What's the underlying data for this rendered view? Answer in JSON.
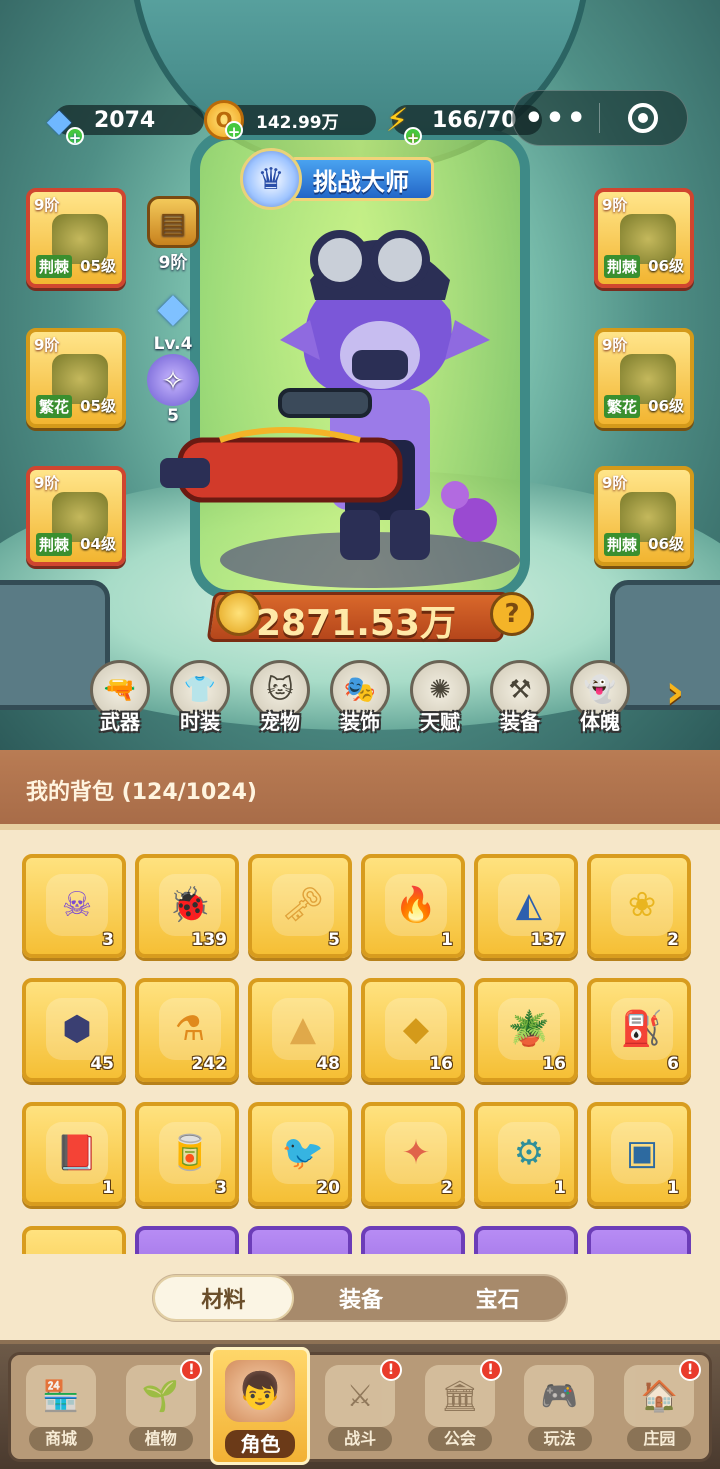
{
  "top_bar": {
    "gems": "2074",
    "coins": "142.99万",
    "energy": "166/70",
    "menu_dots": "•••"
  },
  "title_badge": "挑战大师",
  "equipment_left": [
    {
      "tier": "9阶",
      "tag": "荆棘",
      "level": "05级",
      "frame": "red"
    },
    {
      "tier": "9阶",
      "tag": "繁花",
      "level": "05级",
      "frame": "gold"
    },
    {
      "tier": "9阶",
      "tag": "荆棘",
      "level": "04级",
      "frame": "red"
    }
  ],
  "equipment_right": [
    {
      "tier": "9阶",
      "tag": "荆棘",
      "level": "06级",
      "frame": "red"
    },
    {
      "tier": "9阶",
      "tag": "繁花",
      "level": "06级",
      "frame": "gold"
    },
    {
      "tier": "9阶",
      "tag": "荆棘",
      "level": "06级",
      "frame": "gold"
    }
  ],
  "hero_stats": {
    "weapon_tier": "9阶",
    "level": "Lv.4",
    "star_count": "5"
  },
  "power": "2871.53万",
  "help_label": "?",
  "tabs": [
    "武器",
    "时装",
    "宠物",
    "装饰",
    "天赋",
    "装备",
    "体魄"
  ],
  "bag": {
    "title": "我的背包 (124/1024)",
    "items": [
      {
        "icon": "skull-scroll-icon",
        "glyph": "☠",
        "count": "3",
        "color": "#7c4bd1"
      },
      {
        "icon": "ladybug-icon",
        "glyph": "🐞",
        "count": "139",
        "color": "#d2402c"
      },
      {
        "icon": "key-icon",
        "glyph": "🗝",
        "count": "5",
        "color": "#e0a23a"
      },
      {
        "icon": "flame-gem-icon",
        "glyph": "🔥",
        "count": "1",
        "color": "#e04a1c"
      },
      {
        "icon": "prism-icon",
        "glyph": "◭",
        "count": "137",
        "color": "#2d5fae"
      },
      {
        "icon": "golden-bud-icon",
        "glyph": "❀",
        "count": "2",
        "color": "#e9b51f"
      },
      {
        "icon": "rune-stone-icon",
        "glyph": "⬢",
        "count": "45",
        "color": "#3a3f72"
      },
      {
        "icon": "potion-icon",
        "glyph": "⚗",
        "count": "242",
        "color": "#e08a1c"
      },
      {
        "icon": "sand-pile-icon",
        "glyph": "▲",
        "count": "48",
        "color": "#e0a94a"
      },
      {
        "icon": "gold-ore-icon",
        "glyph": "◆",
        "count": "16",
        "color": "#d49a1a"
      },
      {
        "icon": "flower-pot-icon",
        "glyph": "🪴",
        "count": "16",
        "color": "#b97a3a"
      },
      {
        "icon": "spray-tank-icon",
        "glyph": "⛽",
        "count": "6",
        "color": "#7aa33a"
      },
      {
        "icon": "spell-book-icon",
        "glyph": "📕",
        "count": "1",
        "color": "#a46ad8"
      },
      {
        "icon": "canned-food-icon",
        "glyph": "🥫",
        "count": "3",
        "color": "#d9782c"
      },
      {
        "icon": "bird-puzzle-icon",
        "glyph": "🐦",
        "count": "20",
        "color": "#d4a23a"
      },
      {
        "icon": "crystal-shard-icon",
        "glyph": "✦",
        "count": "2",
        "color": "#e0644a"
      },
      {
        "icon": "bobbin-icon",
        "glyph": "⚙",
        "count": "1",
        "color": "#2f8f9a"
      },
      {
        "icon": "blueprint-icon",
        "glyph": "▣",
        "count": "1",
        "color": "#2d6aa0"
      },
      {
        "icon": "partial-item-icon",
        "glyph": "",
        "count": "",
        "color": "#e0a23a"
      },
      {
        "icon": "partial-item-icon",
        "glyph": "",
        "count": "",
        "color": "#6c3db8"
      },
      {
        "icon": "partial-item-icon",
        "glyph": "",
        "count": "",
        "color": "#6c3db8"
      },
      {
        "icon": "partial-item-icon",
        "glyph": "",
        "count": "",
        "color": "#6c3db8"
      },
      {
        "icon": "partial-item-icon",
        "glyph": "",
        "count": "",
        "color": "#6c3db8"
      },
      {
        "icon": "partial-item-icon",
        "glyph": "",
        "count": "",
        "color": "#6c3db8"
      }
    ]
  },
  "switcher": {
    "active": "材料",
    "options": [
      "材料",
      "装备",
      "宝石"
    ]
  },
  "nav": [
    {
      "label": "商城",
      "icon": "shop-icon",
      "glyph": "🏪",
      "badge": ""
    },
    {
      "label": "植物",
      "icon": "plant-icon",
      "glyph": "🌱",
      "badge": "!"
    },
    {
      "label": "角色",
      "icon": "character-icon",
      "glyph": "👦",
      "badge": "",
      "active": true
    },
    {
      "label": "战斗",
      "icon": "battle-icon",
      "glyph": "⚔",
      "badge": "!"
    },
    {
      "label": "公会",
      "icon": "guild-icon",
      "glyph": "🏛",
      "badge": "!"
    },
    {
      "label": "玩法",
      "icon": "gameplay-icon",
      "glyph": "🎮",
      "badge": ""
    },
    {
      "label": "庄园",
      "icon": "manor-icon",
      "glyph": "🏠",
      "badge": "!"
    }
  ]
}
